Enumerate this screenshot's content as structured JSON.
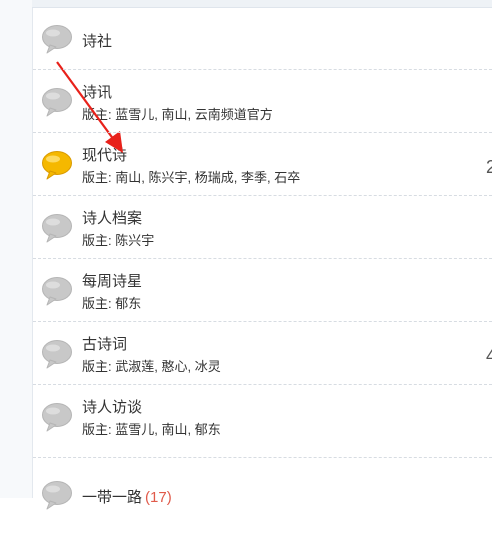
{
  "forums": [
    {
      "name": "诗社",
      "mod_label": "",
      "mods": [],
      "count": "",
      "side_number": "",
      "highlight": false
    },
    {
      "name": "诗讯",
      "mod_label": "版主: ",
      "mods": [
        "蓝雪儿",
        "南山",
        "云南频道官方"
      ],
      "count": "",
      "side_number": "",
      "highlight": false
    },
    {
      "name": "现代诗",
      "mod_label": "版主: ",
      "mods": [
        "南山",
        "陈兴宇",
        "杨瑞成",
        "李季",
        "石卒"
      ],
      "count": "",
      "side_number": "2",
      "highlight": true
    },
    {
      "name": "诗人档案",
      "mod_label": "版主: ",
      "mods": [
        "陈兴宇"
      ],
      "count": "",
      "side_number": "",
      "highlight": false
    },
    {
      "name": "每周诗星",
      "mod_label": "版主: ",
      "mods": [
        "郁东"
      ],
      "count": "",
      "side_number": "",
      "highlight": false
    },
    {
      "name": "古诗词",
      "mod_label": "版主: ",
      "mods": [
        "武淑莲",
        "憨心",
        "冰灵"
      ],
      "count": "",
      "side_number": "4",
      "highlight": false
    },
    {
      "name": "诗人访谈",
      "mod_label": "版主: ",
      "mods": [
        "蓝雪儿",
        "南山",
        "郁东"
      ],
      "count": "",
      "side_number": "",
      "highlight": false
    },
    {
      "name": "一带一路",
      "mod_label": "",
      "mods": [],
      "count": "(17)",
      "side_number": "",
      "highlight": false
    }
  ],
  "colors": {
    "bubble_gray": "#c8c8c8",
    "bubble_yellow": "#f5b800",
    "count_red": "#e05a4a",
    "arrow_red": "#e8211a"
  },
  "icons": {
    "forum_status": "speech-bubble-icon"
  }
}
